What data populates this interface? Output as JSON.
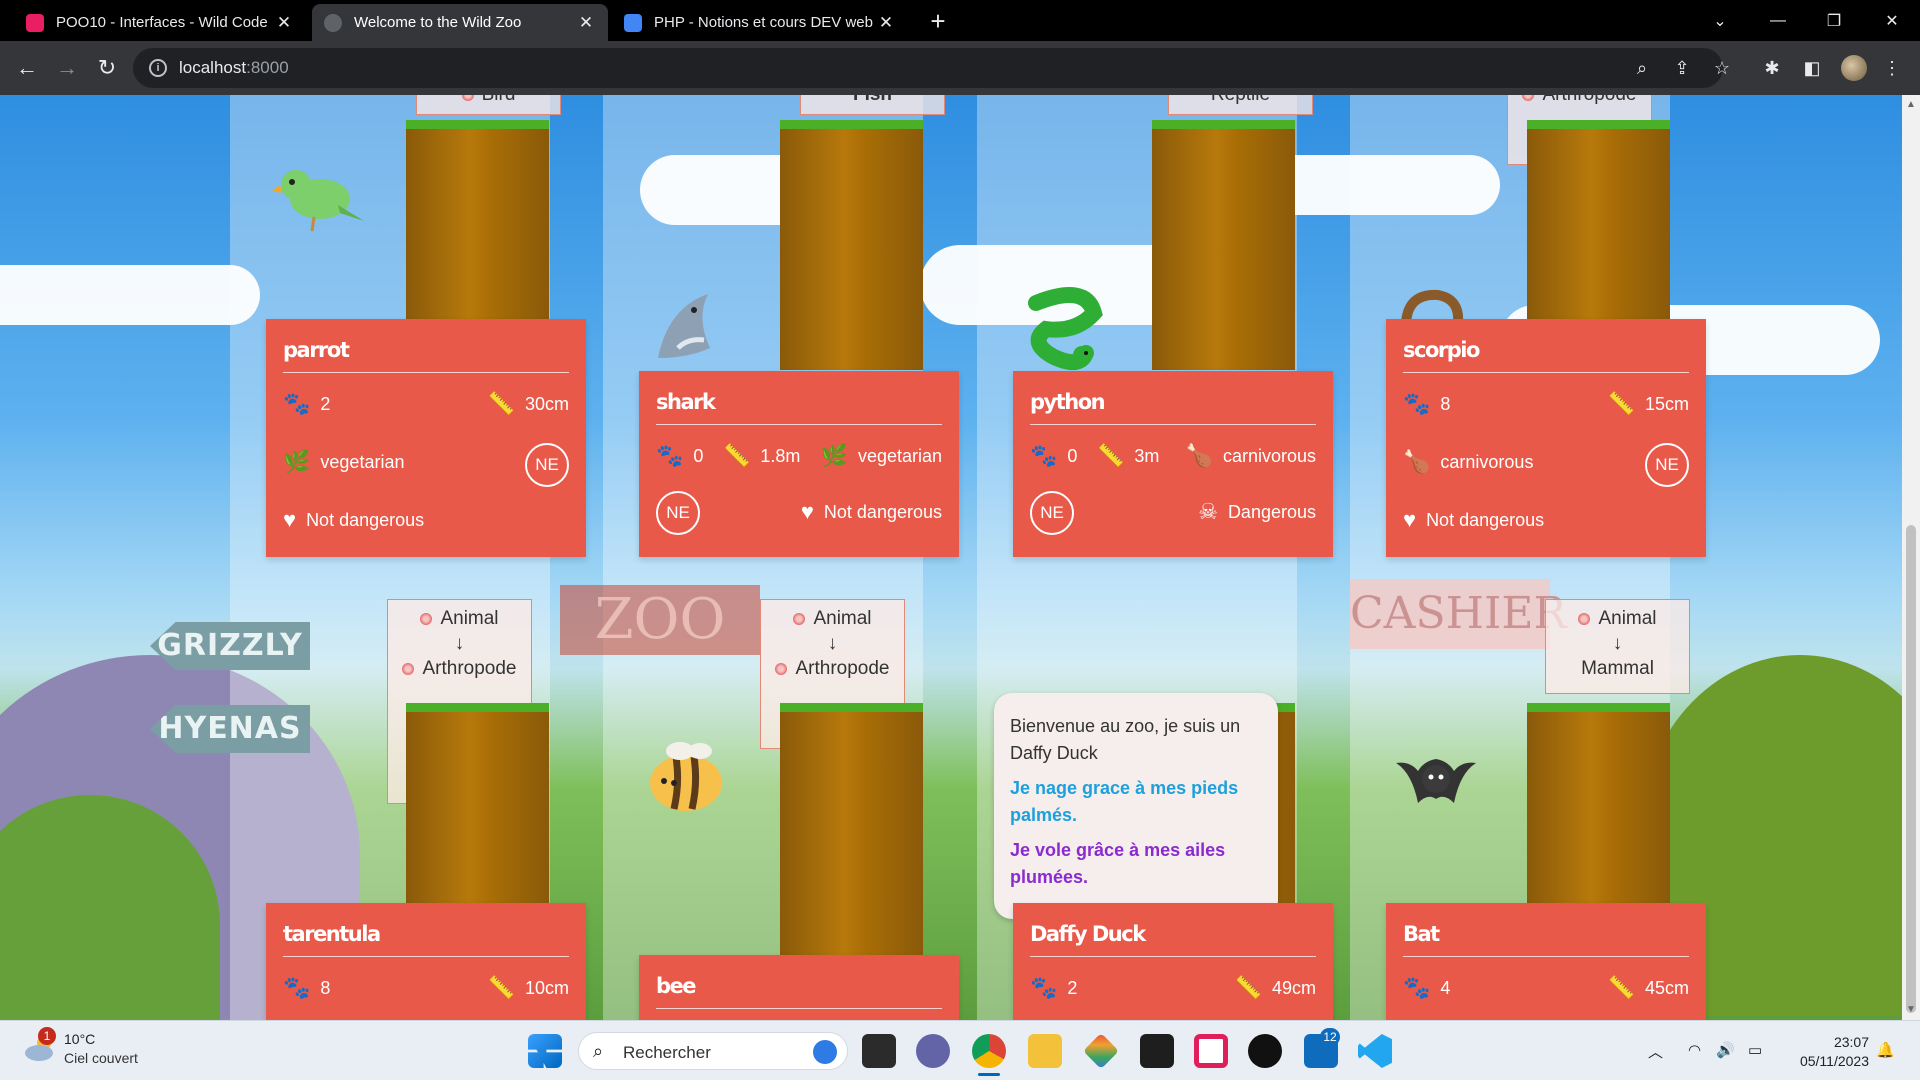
{
  "browser": {
    "tabs": [
      {
        "title": "POO10 - Interfaces - Wild Code",
        "close": "✕",
        "active": false
      },
      {
        "title": "Welcome to the Wild Zoo",
        "close": "✕",
        "active": true
      },
      {
        "title": "PHP - Notions et cours DEV web",
        "close": "✕",
        "active": false
      }
    ],
    "new_tab": "+",
    "url_host": "localhost",
    "url_port": ":8000",
    "window_controls": {
      "dropdown": "⌄",
      "minimize": "—",
      "restore": "❐",
      "close": "✕"
    }
  },
  "page": {
    "top_labels": [
      "Bird",
      "Fish",
      "Reptile",
      "Arthropode"
    ],
    "hierarchy_labels": [
      {
        "top": "Animal",
        "arrow": "↓",
        "bottom": "Arthropode"
      },
      {
        "top": "Animal",
        "arrow": "↓",
        "bottom": "Arthropode"
      },
      {
        "top": "Animal",
        "arrow": "↓",
        "bottom": "Mammal"
      }
    ],
    "signs": {
      "grizzly": "GRIZZLY",
      "hyenas": "HYENAS",
      "zoo": "ZOO",
      "cashier": "CASHIER"
    },
    "cards": {
      "parrot": {
        "name": "parrot",
        "legs": "2",
        "size": "30cm",
        "diet": "vegetarian",
        "status": "NE",
        "danger": "Not dangerous"
      },
      "shark": {
        "name": "shark",
        "legs": "0",
        "size": "1.8m",
        "diet": "vegetarian",
        "status": "NE",
        "danger": "Not dangerous"
      },
      "python": {
        "name": "python",
        "legs": "0",
        "size": "3m",
        "diet": "carnivorous",
        "status": "NE",
        "danger": "Dangerous"
      },
      "scorpio": {
        "name": "scorpio",
        "legs": "8",
        "size": "15cm",
        "diet": "carnivorous",
        "status": "NE",
        "danger": "Not dangerous"
      },
      "tarentula": {
        "name": "tarentula",
        "legs": "8",
        "size": "10cm"
      },
      "bee": {
        "name": "bee"
      },
      "daffy": {
        "name": "Daffy Duck",
        "legs": "2",
        "size": "49cm"
      },
      "bat": {
        "name": "Bat",
        "legs": "4",
        "size": "45cm"
      }
    },
    "bubble": {
      "intro": "Bienvenue au zoo, je suis un Daffy Duck",
      "swim": "Je nage grace à mes pieds palmés.",
      "fly": "Je vole grâce à mes ailes plumées."
    },
    "icons": {
      "legs": "paw-icon",
      "size": "ruler-icon",
      "vegetarian": "leaf-icon",
      "carnivorous": "drumstick-icon",
      "safe": "heart-icon",
      "danger": "skull-icon"
    }
  },
  "taskbar": {
    "weather_temp": "10°C",
    "weather_desc": "Ciel couvert",
    "weather_badge": "1",
    "search_placeholder": "Rechercher",
    "notif_badge": "12",
    "time": "23:07",
    "date": "05/11/2023"
  },
  "colors": {
    "card": "#e8594a",
    "grass": "#4caf28",
    "accent_blue": "#1ea0dc",
    "accent_purple": "#8a2bd0"
  }
}
